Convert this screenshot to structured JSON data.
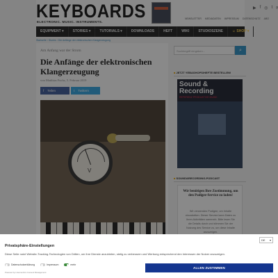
{
  "site": {
    "logo": "KEYBOARDS",
    "tagline": "ELECTRONIC. MUSIC. INSTRUMENTS.",
    "top_links": [
      "NEWSLETTER",
      "MEDIADATEN",
      "IMPRESSUM",
      "DATENSCHUTZ",
      "ABO"
    ],
    "social_icons": [
      "youtube-icon",
      "facebook-icon",
      "instagram-icon",
      "twitter-icon",
      "mail-icon"
    ],
    "nav": [
      {
        "label": "EQUIPMENT ▾"
      },
      {
        "label": "STORIES ▾"
      },
      {
        "label": "TUTORIALS ▾"
      },
      {
        "label": "DOWNLOADS"
      },
      {
        "label": "HEFT"
      },
      {
        "label": "WIKI"
      },
      {
        "label": "STUDIOSZENE"
      },
      {
        "label": "☺ SHOP ▾"
      }
    ],
    "breadcrumb": "Startseite › Stories › Die Anfänge der elektronischen Klangerzeugung"
  },
  "article": {
    "kicker": "Am Anfang war der Strom",
    "title": "Die Anfänge der elektronischen Klangerzeugung",
    "byline": "von Matthias Fuchs, 5. Februar 2019",
    "share_facebook": "Teilen",
    "share_twitter": "Twittern",
    "hero_gauge_label": "V"
  },
  "sidebar": {
    "search_placeholder": "Suchbegriff eingeben...",
    "heading_current": "JETZT YEBASHOPS/HEFTE BESTELLEN!",
    "cover_title": "Sound & Recording",
    "cover_subtitle": "REFERENZ PRODUKTIVE MUSIK",
    "heading_podcast": "SOUND&RECORDING-PODCAST",
    "promo_heading": "Wir benötigen Ihre Zustimmung, um den Podigee-Service zu laden!",
    "promo_body": "Wir verwenden Podigee, um Inhalte einzubetten. Dieser Service kann Daten zu Ihren Aktivitäten sammeln. Bitte lesen Sie die Details durch und stimmen Sie der Nutzung des Service zu, um diese Inhalte anzuzeigen."
  },
  "consent": {
    "title": "Privatsphäre-Einstellungen",
    "description": "Diese Seite nutzt Website-Tracking-Technologien von Dritten, um ihre Dienste anzubieten, stetig zu verbessern und Werbung entsprechend den Interessen der Nutzer anzuzeigen.",
    "language": "DE",
    "toggles": [
      {
        "label": "Datenschutzerklärung",
        "on": false
      },
      {
        "label": "Impressum",
        "on": false
      },
      {
        "label": "mehr",
        "on": true
      }
    ],
    "powered_by": "Powered by Usercentrics Consent Management",
    "accept_label": "ALLEN ZUSTIMMEN",
    "accept_color": "#14358f"
  }
}
